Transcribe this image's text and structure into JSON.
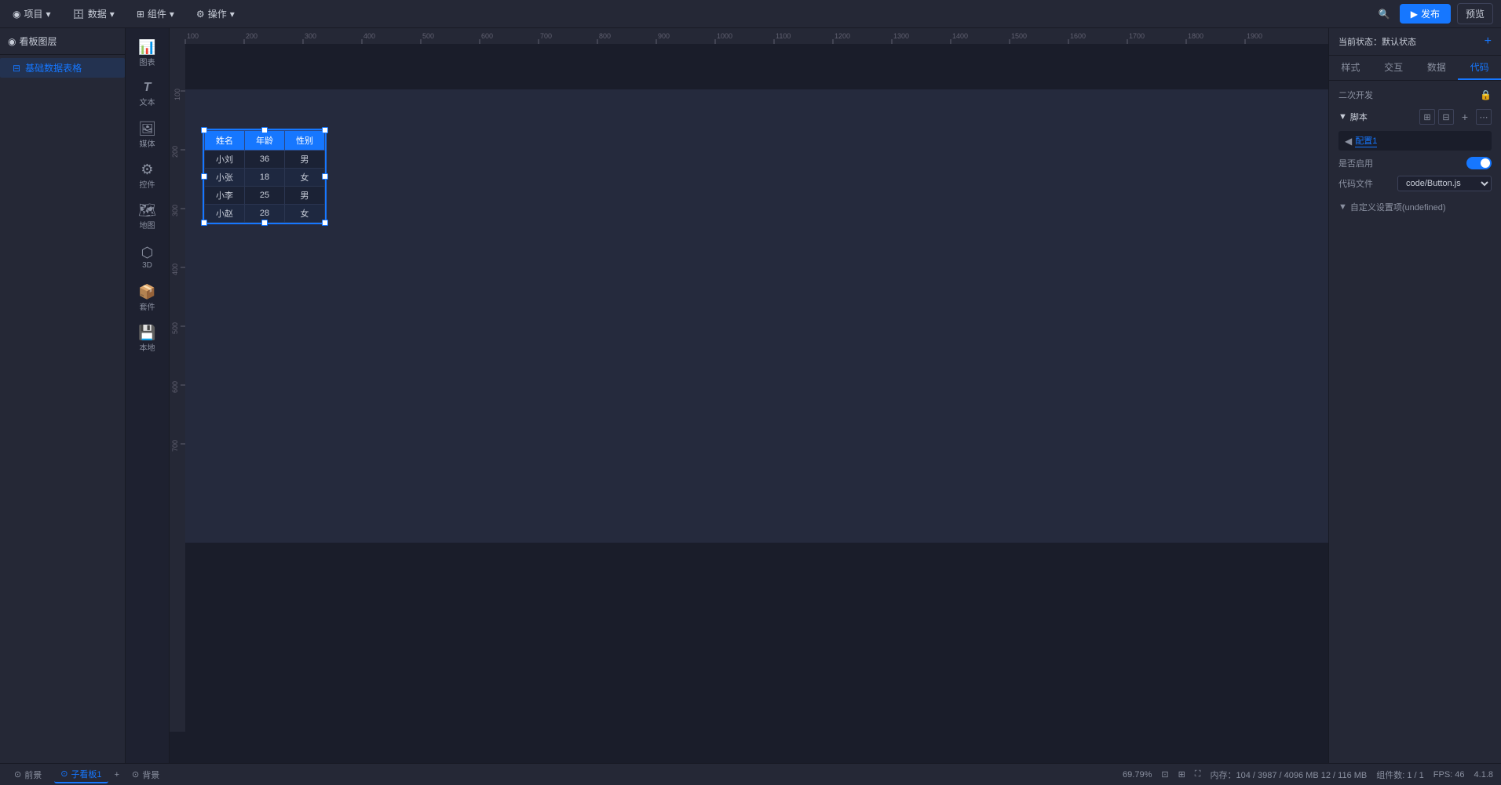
{
  "topbar": {
    "items": [
      {
        "label": "项目",
        "icon": "◉"
      },
      {
        "label": "数据",
        "icon": "🗄"
      },
      {
        "label": "组件",
        "icon": "⊞"
      },
      {
        "label": "操作",
        "icon": "⚙"
      }
    ],
    "publish_label": "发布",
    "preview_label": "预览"
  },
  "left_panel": {
    "title": "看板图层",
    "icon": "◉",
    "tree_items": [
      {
        "label": "基础数据表格",
        "icon": "⊟",
        "selected": true
      }
    ]
  },
  "components": [
    {
      "label": "图表",
      "icon": "📊"
    },
    {
      "label": "文本",
      "icon": "T"
    },
    {
      "label": "媒体",
      "icon": "🖼"
    },
    {
      "label": "控件",
      "icon": "⚙"
    },
    {
      "label": "地图",
      "icon": "🗺"
    },
    {
      "label": "3D",
      "icon": "🎲"
    },
    {
      "label": "套件",
      "icon": "📦"
    },
    {
      "label": "本地",
      "icon": "💾"
    }
  ],
  "canvas": {
    "ruler_labels_h": [
      "100",
      "200",
      "300",
      "400",
      "500",
      "600",
      "700",
      "800",
      "900",
      "1000",
      "1100",
      "1200",
      "1300",
      "1400",
      "1500",
      "1600",
      "1700",
      "1800",
      "1900"
    ],
    "cursor_icon": "default"
  },
  "table_widget": {
    "headers": [
      "姓名",
      "年龄",
      "性别"
    ],
    "rows": [
      [
        "小刘",
        "36",
        "男"
      ],
      [
        "小张",
        "18",
        "女"
      ],
      [
        "小李",
        "25",
        "男"
      ],
      [
        "小赵",
        "28",
        "女"
      ]
    ]
  },
  "right_panel": {
    "status_label": "当前状态：默认状态",
    "add_icon": "+",
    "tabs": [
      "样式",
      "交互",
      "数据",
      "代码"
    ],
    "active_tab": "代码",
    "secondary_dev": {
      "title": "二次开发",
      "lock_icon": "🔒",
      "script_section": "脚本",
      "config_tab_label": "配置1",
      "enable_label": "是否启用",
      "enabled": true,
      "code_file_label": "代码文件",
      "code_file_value": "code/Button.js",
      "custom_settings_label": "自定义设置项(undefined)"
    }
  },
  "bottom_bar": {
    "pages": [
      {
        "label": "前景",
        "active": false,
        "dot": true
      },
      {
        "label": "子看板1",
        "active": true,
        "dot": false
      },
      {
        "label": "背景",
        "active": false,
        "dot": true
      }
    ],
    "add_icon": "+",
    "zoom": "69.79%",
    "memory": "内存：104 / 3987 / 4096 MB  12 / 116 MB",
    "fps": "FPS: 46",
    "component_count": "组件数: 1 / 1",
    "version": "4.1.8"
  }
}
